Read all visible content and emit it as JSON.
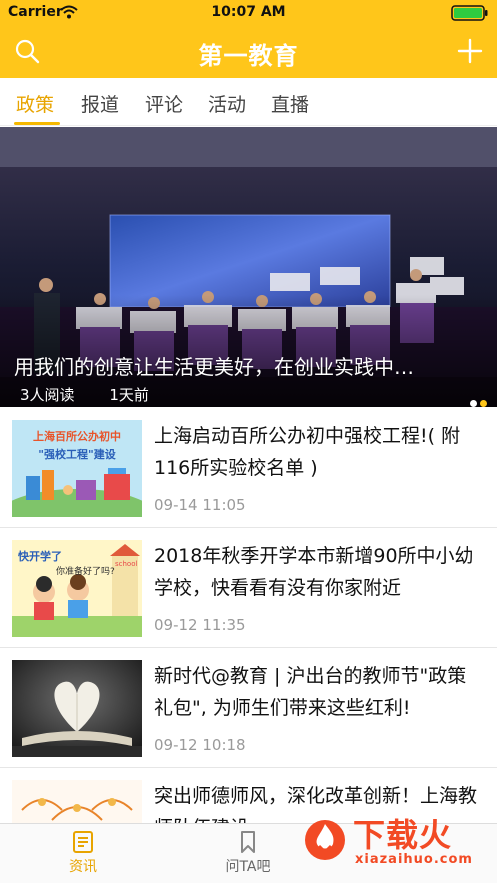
{
  "status": {
    "carrier": "Carrier",
    "time": "10:07 AM"
  },
  "nav": {
    "title": "第一教育",
    "search_icon": "search-icon",
    "add_icon": "plus-icon"
  },
  "tabs": [
    {
      "label": "政策",
      "active": true
    },
    {
      "label": "报道",
      "active": false
    },
    {
      "label": "评论",
      "active": false
    },
    {
      "label": "活动",
      "active": false
    },
    {
      "label": "直播",
      "active": false
    }
  ],
  "hero": {
    "title": "用我们的创意让生活更美好，在创业实践中…",
    "reads": "3人阅读",
    "time": "1天前",
    "page_indicator": {
      "count": 2,
      "active_index": 1
    }
  },
  "articles": [
    {
      "title": "上海启动百所公办初中强校工程!( 附116所实验校名单 )",
      "time": "09-14 11:05",
      "thumb_text_1": "上海百所公办初中",
      "thumb_text_2": "\"强校工程\"建设"
    },
    {
      "title": "2018年秋季开学本市新增90所中小幼学校，快看看有没有你家附近",
      "time": "09-12 11:35",
      "thumb_text_1": "快开学了",
      "thumb_text_2": "你准备好了吗?",
      "thumb_text_3": "school"
    },
    {
      "title": "新时代@教育 | 沪出台的教师节\"政策礼包\", 为师生们带来这些红利!",
      "time": "09-12 10:18"
    },
    {
      "title": "突出师德师风，深化改革创新！上海教师队伍建设…",
      "time": ""
    }
  ],
  "tabbar": [
    {
      "label": "资讯",
      "icon": "news-icon",
      "active": true
    },
    {
      "label": "问TA吧",
      "icon": "bookmark-icon",
      "active": false
    }
  ],
  "watermark": {
    "text": "下载火",
    "sub": "xiazaihuo.com"
  },
  "colors": {
    "brand": "#ffc61a",
    "accent": "#e8a400",
    "text": "#111111",
    "muted": "#9a9a9a"
  }
}
